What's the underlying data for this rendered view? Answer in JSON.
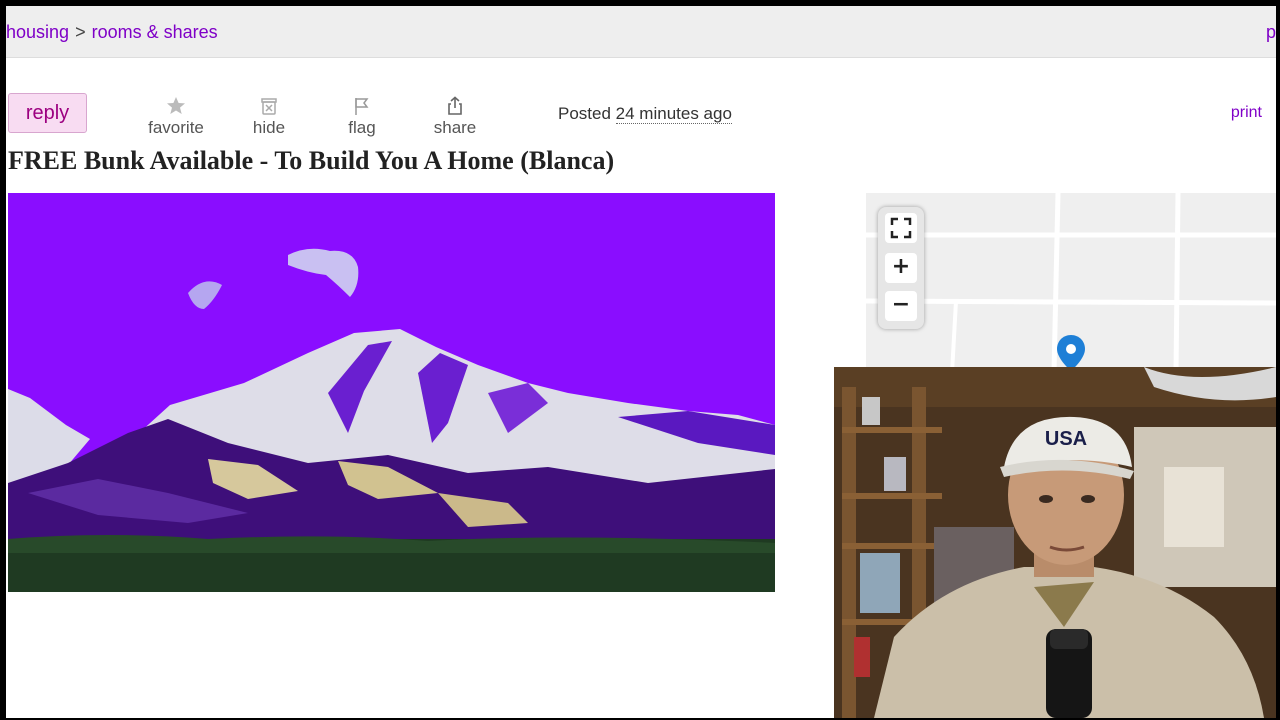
{
  "breadcrumb": {
    "items": [
      "housing",
      "rooms & shares"
    ],
    "separator": ">",
    "right_fragment": "p"
  },
  "actions": {
    "reply_label": "reply",
    "favorite_label": "favorite",
    "hide_label": "hide",
    "flag_label": "flag",
    "share_label": "share",
    "posted_prefix": "Posted",
    "posted_time": "24 minutes ago",
    "print_label": "print"
  },
  "post": {
    "title": "FREE Bunk Available - To Build You A Home (Blanca)"
  },
  "map": {
    "fullscreen_icon": "fullscreen-icon",
    "zoom_in_label": "+",
    "zoom_out_label": "−",
    "marker_color": "#1e7fd6"
  },
  "webcam": {
    "cap_text": "USA"
  },
  "colors": {
    "link": "#7f00c7",
    "reply_bg": "#f8dcf2",
    "image_sky": "#8a0dff"
  }
}
